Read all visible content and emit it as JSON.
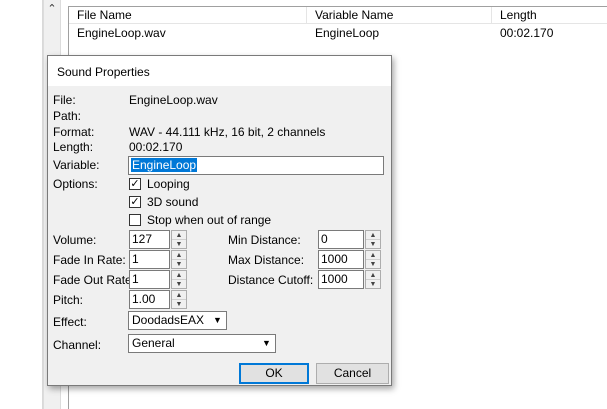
{
  "background": {
    "list_headers": [
      "File Name",
      "Variable Name",
      "Length"
    ],
    "list_rows": [
      {
        "file": "EngineLoop.wav",
        "variable": "EngineLoop",
        "length": "00:02.170"
      }
    ]
  },
  "dialog": {
    "title": "Sound Properties",
    "file_label": "File:",
    "file_value": "EngineLoop.wav",
    "path_label": "Path:",
    "path_value": "",
    "format_label": "Format:",
    "format_value": "WAV - 44.111 kHz, 16 bit, 2 channels",
    "length_label": "Length:",
    "length_value": "00:02.170",
    "variable_label": "Variable:",
    "variable_value": "EngineLoop",
    "options_label": "Options:",
    "options": [
      {
        "label": "Looping",
        "checked": true
      },
      {
        "label": "3D sound",
        "checked": true
      },
      {
        "label": "Stop when out of range",
        "checked": false
      }
    ],
    "volume_label": "Volume:",
    "volume_value": "127",
    "fade_in_label": "Fade In Rate:",
    "fade_in_value": "1",
    "fade_out_label": "Fade Out Rate:",
    "fade_out_value": "1",
    "pitch_label": "Pitch:",
    "pitch_value": "1.00",
    "min_distance_label": "Min Distance:",
    "min_distance_value": "0",
    "max_distance_label": "Max Distance:",
    "max_distance_value": "1000",
    "distance_cutoff_label": "Distance Cutoff:",
    "distance_cutoff_value": "1000",
    "effect_label": "Effect:",
    "effect_value": "DoodadsEAX",
    "channel_label": "Channel:",
    "channel_value": "General",
    "ok_label": "OK",
    "cancel_label": "Cancel"
  }
}
